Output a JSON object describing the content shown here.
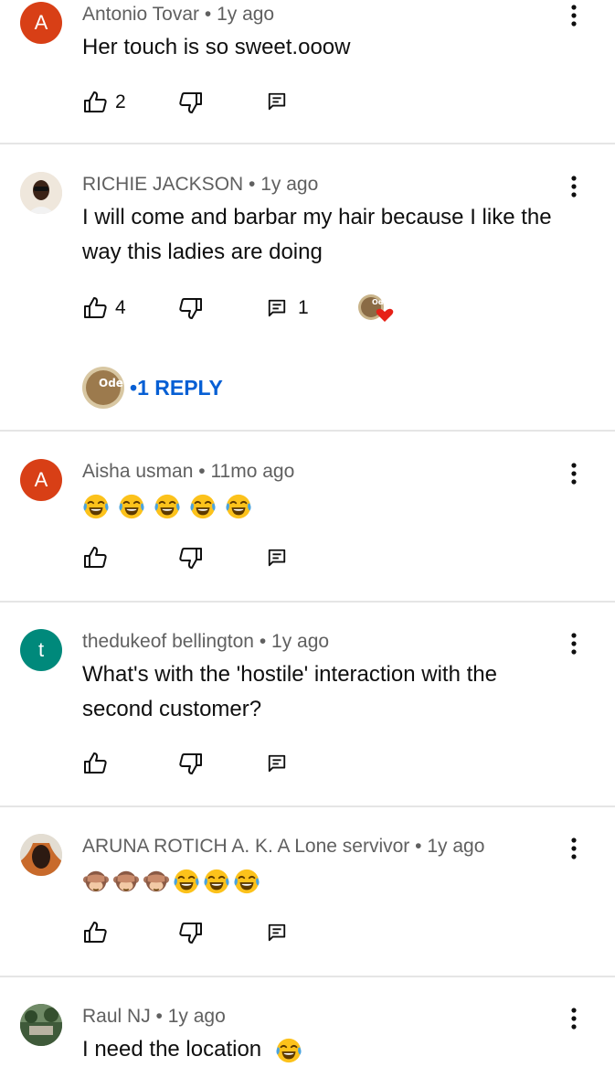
{
  "comments": [
    {
      "author": "Antonio Tovar",
      "age": "1y ago",
      "text": "Her touch is so sweet.ooow",
      "avatar_letter": "A",
      "avatar_color": "#d83f16",
      "likes": "2",
      "replies": ""
    },
    {
      "author": "RICHIE JACKSON",
      "age": "1y ago",
      "text": "I will come and barbar my hair because I like the way this ladies are doing",
      "avatar_letter": "",
      "likes": "4",
      "replies": "1",
      "creator_heart": true,
      "creator_badge_text": "Ode",
      "reply_link": "1 REPLY"
    },
    {
      "author": "Aisha usman",
      "age": "11mo ago",
      "text": "",
      "emojis": [
        "tears-of-joy",
        "tears-of-joy",
        "tears-of-joy",
        "tears-of-joy",
        "tears-of-joy"
      ],
      "avatar_letter": "A",
      "avatar_color": "#d83f16",
      "likes": "",
      "replies": ""
    },
    {
      "author": "thedukeof bellington",
      "age": "1y ago",
      "text": "What's with the 'hostile' interaction with the second customer?",
      "avatar_letter": "t",
      "avatar_color": "#00897b",
      "likes": "",
      "replies": ""
    },
    {
      "author": "ARUNA ROTICH A. K. A Lone servivor",
      "age": "1y ago",
      "text": "",
      "emojis": [
        "see-no-evil",
        "see-no-evil",
        "see-no-evil",
        "tears-of-joy",
        "tears-of-joy",
        "tears-of-joy"
      ],
      "avatar_letter": "",
      "likes": "",
      "replies": ""
    },
    {
      "author": "Raul NJ",
      "age": "1y ago",
      "text": "I need the location",
      "trailing_emoji": "tears-of-joy",
      "avatar_letter": "",
      "likes": "",
      "replies": ""
    }
  ],
  "separator": " • ",
  "colors": {
    "link": "#065fd4",
    "meta": "#606060",
    "divider": "#e5e5e5"
  }
}
